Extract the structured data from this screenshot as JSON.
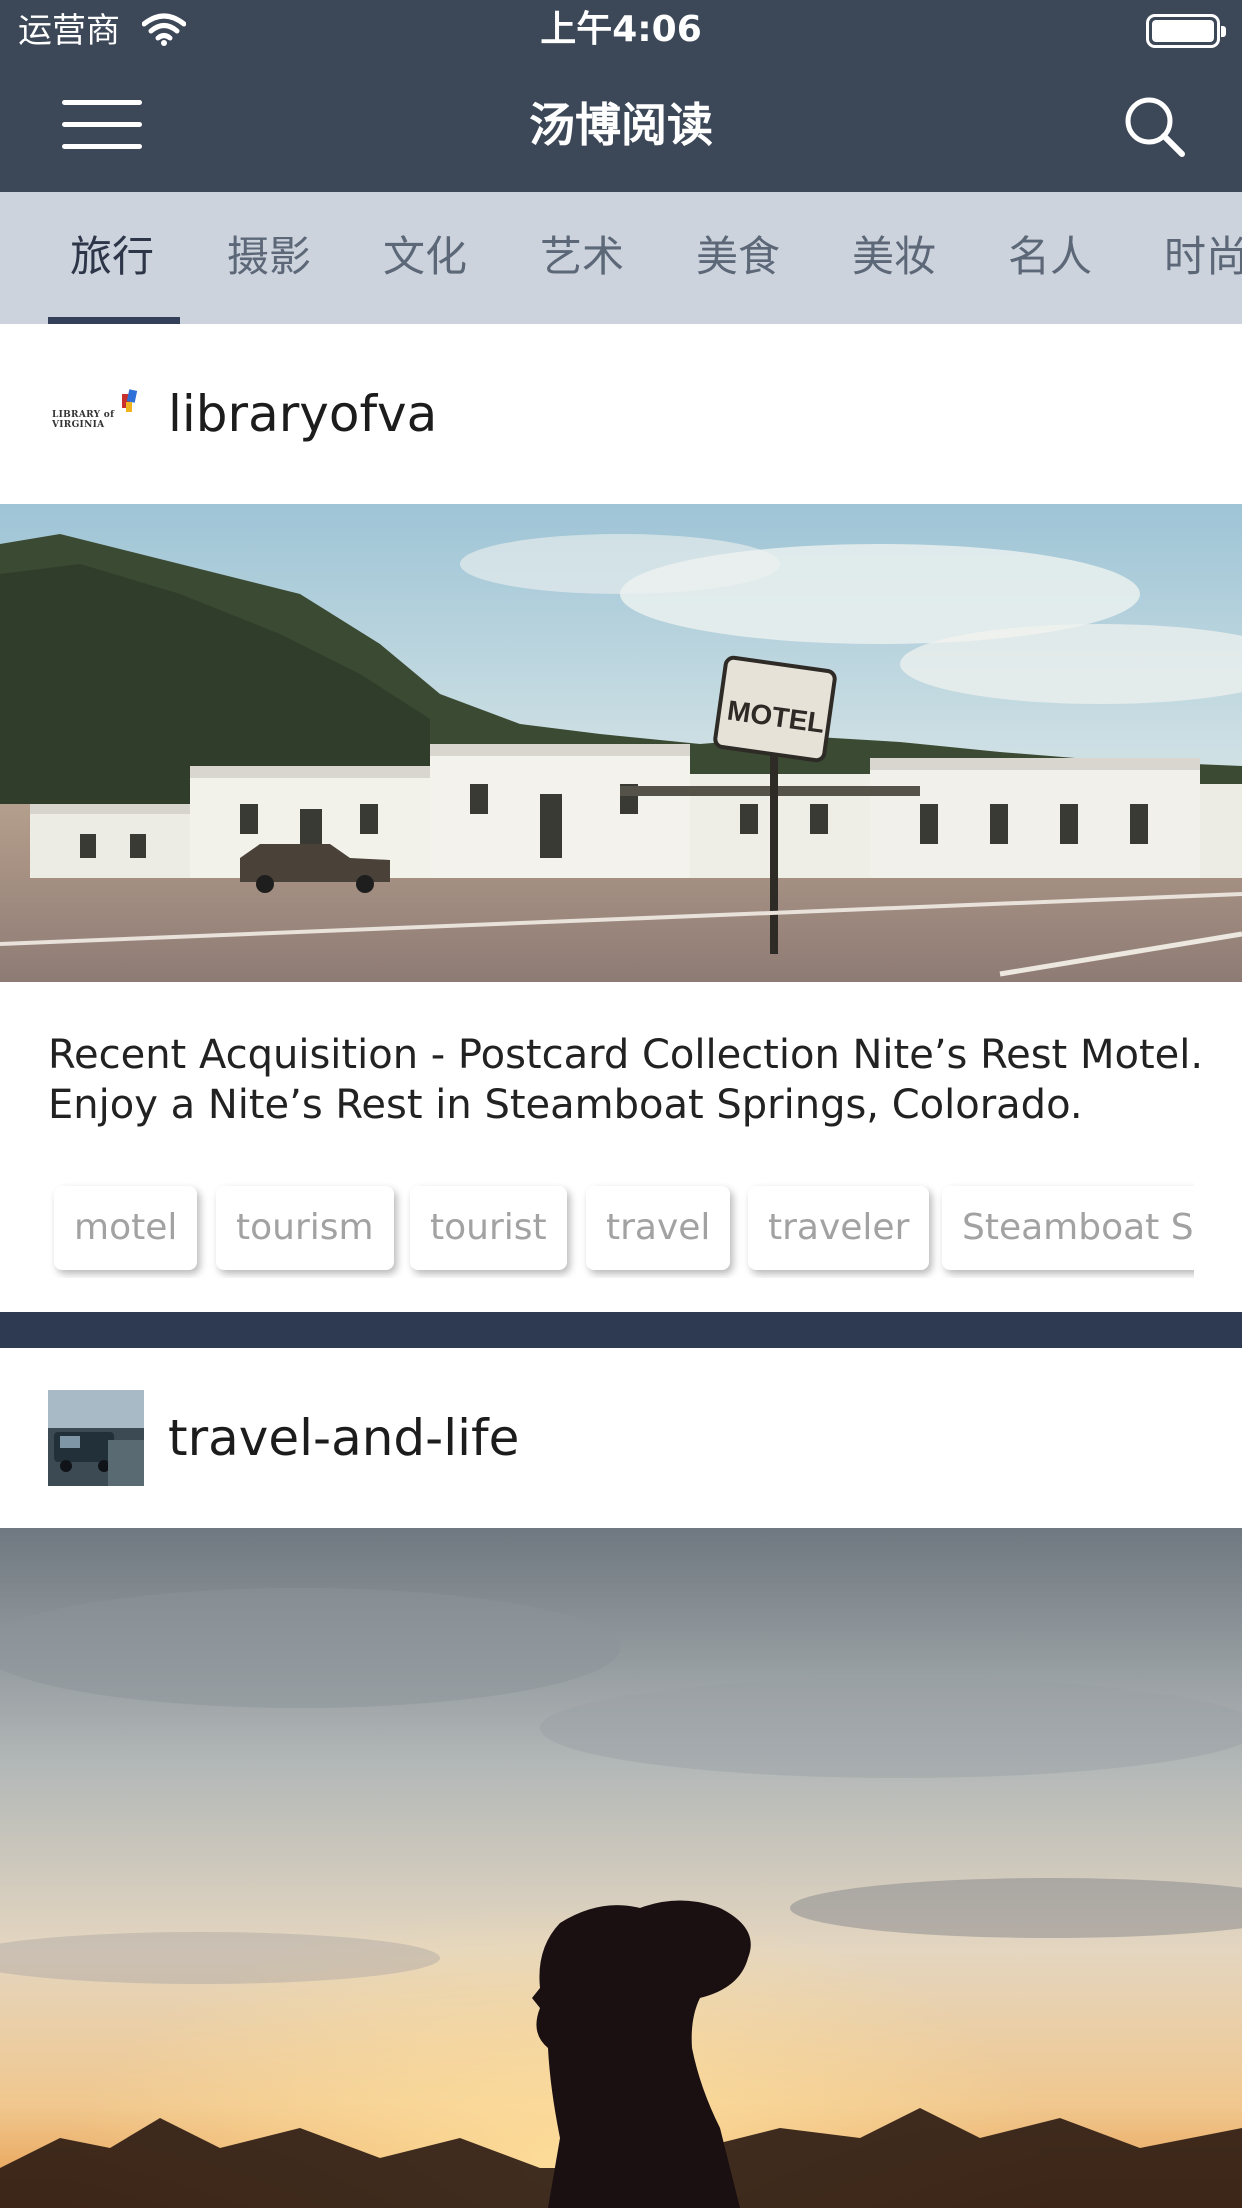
{
  "status_bar": {
    "carrier": "运营商",
    "time": "上午4:06"
  },
  "nav": {
    "title": "汤博阅读"
  },
  "tabs": [
    {
      "label": "旅行",
      "active": true
    },
    {
      "label": "摄影",
      "active": false
    },
    {
      "label": "文化",
      "active": false
    },
    {
      "label": "艺术",
      "active": false
    },
    {
      "label": "美食",
      "active": false
    },
    {
      "label": "美妆",
      "active": false
    },
    {
      "label": "名人",
      "active": false
    },
    {
      "label": "时尚",
      "active": false
    }
  ],
  "posts": [
    {
      "author": "libraryofva",
      "avatar_text": "LIBRARY of VIRGINIA",
      "caption": "Recent Acquisition - Postcard Collection Nite’s Rest Motel. Enjoy a Nite’s Rest in Steamboat Springs, Colorado.",
      "image_sign": "MOTEL",
      "tags": [
        "motel",
        "tourism",
        "tourist",
        "travel",
        "traveler",
        "Steamboat Springs"
      ]
    },
    {
      "author": "travel-and-life"
    }
  ],
  "colors": {
    "header_bg": "#3c4758",
    "tabs_bg": "#cdd3dd",
    "tab_active_text": "#2c3648",
    "tab_text": "#5c6878",
    "divider": "#2e3a52"
  }
}
